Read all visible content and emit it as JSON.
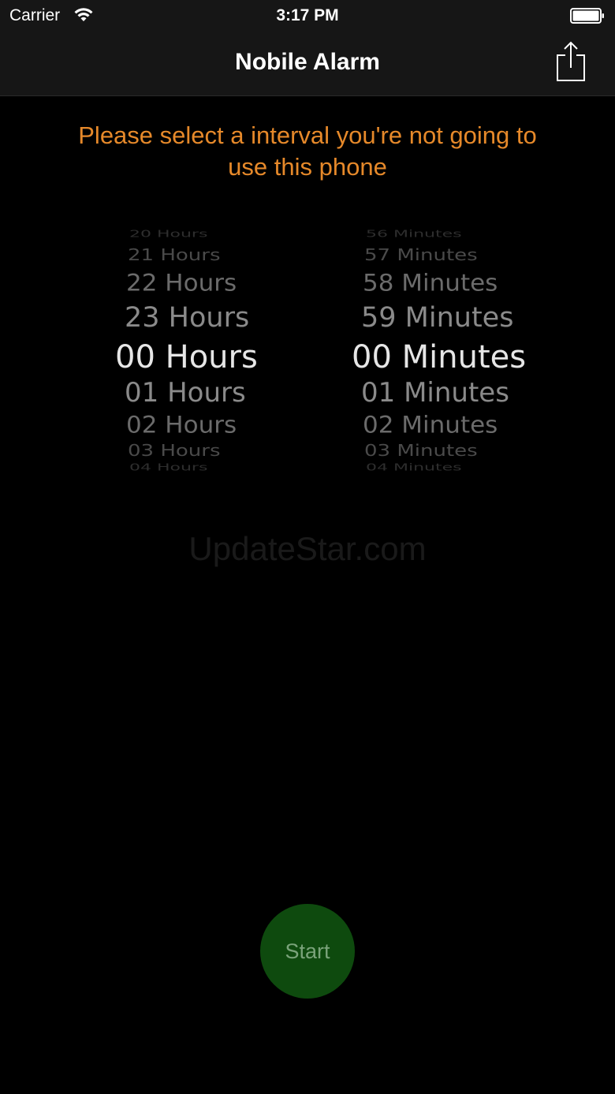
{
  "status_bar": {
    "carrier": "Carrier",
    "time": "3:17 PM",
    "wifi_icon": "wifi-icon",
    "battery_icon": "battery-full-icon"
  },
  "nav_bar": {
    "title": "Nobile Alarm",
    "share_icon": "share-icon"
  },
  "instruction": {
    "line1": "Please select a interval you're not going to",
    "line2": "use this phone",
    "color": "#e6892a"
  },
  "picker": {
    "hours": {
      "rows": [
        "20 Hours",
        "21 Hours",
        "22 Hours",
        "23 Hours",
        "00 Hours",
        "01 Hours",
        "02 Hours",
        "03 Hours",
        "04 Hours"
      ],
      "selected": "00 Hours"
    },
    "minutes": {
      "rows": [
        "56 Minutes",
        "57 Minutes",
        "58 Minutes",
        "59 Minutes",
        "00 Minutes",
        "01 Minutes",
        "02 Minutes",
        "03 Minutes",
        "04 Minutes"
      ],
      "selected": "00 Minutes"
    }
  },
  "watermark": "UpdateStar.com",
  "start_button": {
    "label": "Start",
    "color": "#0e4a0e"
  }
}
